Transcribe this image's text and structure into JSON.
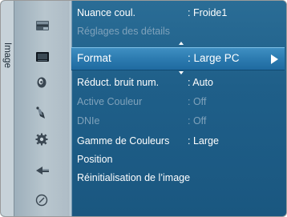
{
  "sidebar": {
    "label": "Image"
  },
  "icons": [
    {
      "name": "screen-icon"
    },
    {
      "name": "picture-icon"
    },
    {
      "name": "sound-icon"
    },
    {
      "name": "channel-icon"
    },
    {
      "name": "settings-gear-icon"
    },
    {
      "name": "input-icon"
    },
    {
      "name": "support-icon"
    }
  ],
  "menu": {
    "items": [
      {
        "label": "Nuance coul.",
        "value": ": Froide1",
        "disabled": false
      },
      {
        "label": "Réglages des détails",
        "value": "",
        "disabled": true
      },
      {
        "label": "Format",
        "value": ": Large PC",
        "selected": true
      },
      {
        "label": "Réduct. bruit num.",
        "value": ": Auto",
        "disabled": false
      },
      {
        "label": "Active Couleur",
        "value": ": Off",
        "disabled": true
      },
      {
        "label": "DNIe",
        "value": ": Off",
        "disabled": true
      },
      {
        "label": "Gamme de Couleurs",
        "value": ": Large",
        "disabled": false
      },
      {
        "label": "Position",
        "value": "",
        "disabled": false
      },
      {
        "label": "Réinitialisation de l’image",
        "value": "",
        "disabled": false
      }
    ]
  },
  "colors": {
    "menu_bg": "#1f5f89",
    "selected_bar": "#2c7bb0",
    "disabled_text": "#7fa2bb",
    "text": "#ffffff"
  }
}
